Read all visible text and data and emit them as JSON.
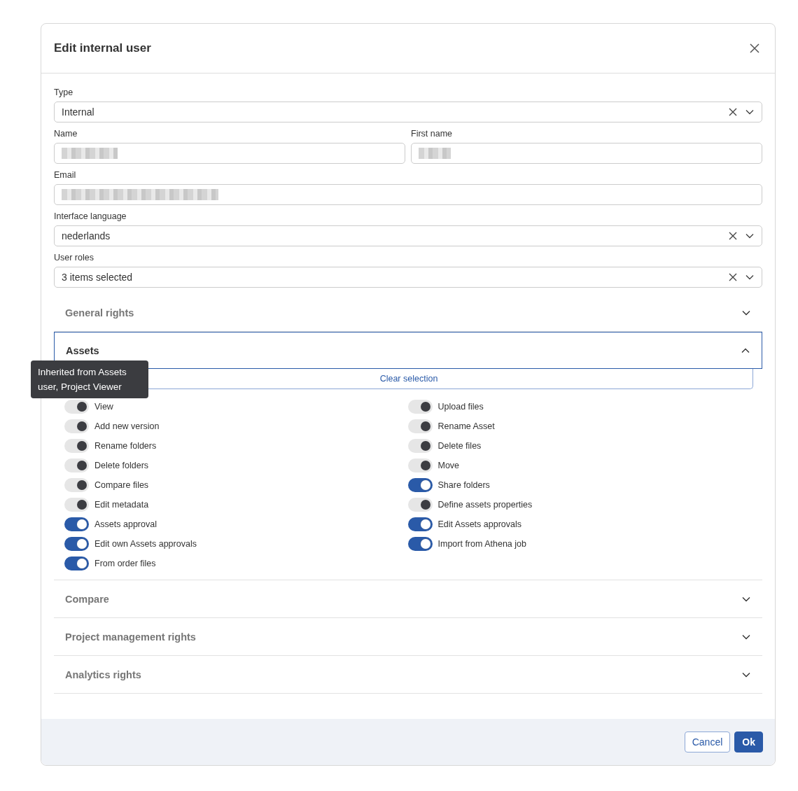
{
  "dialog": {
    "title": "Edit internal user"
  },
  "form_rows": [
    [
      {
        "label": "Type",
        "kind": "select",
        "value": "Internal",
        "redacted": false
      }
    ],
    [
      {
        "label": "Name",
        "kind": "text",
        "redacted": true
      },
      {
        "label": "First name",
        "kind": "text",
        "redacted": true
      }
    ],
    [
      {
        "label": "Email",
        "kind": "text",
        "redacted": true
      }
    ],
    [
      {
        "label": "Interface language",
        "kind": "select",
        "value": "nederlands",
        "redacted": false
      }
    ],
    [
      {
        "label": "User roles",
        "kind": "select",
        "value": "3 items selected",
        "redacted": false
      }
    ]
  ],
  "sections": [
    {
      "title": "General rights",
      "expanded": false
    },
    {
      "title": "Assets",
      "expanded": true,
      "clear_button": "Clear selection",
      "tooltip": "Inherited from Assets user, Project Viewer",
      "permissions_left": [
        {
          "label": "View",
          "on": true,
          "inherited": true
        },
        {
          "label": "Add new version",
          "on": true,
          "inherited": true
        },
        {
          "label": "Rename folders",
          "on": true,
          "inherited": true
        },
        {
          "label": "Delete folders",
          "on": true,
          "inherited": true
        },
        {
          "label": "Compare files",
          "on": true,
          "inherited": true
        },
        {
          "label": "Edit metadata",
          "on": true,
          "inherited": true
        },
        {
          "label": "Assets approval",
          "on": true,
          "inherited": false
        },
        {
          "label": "Edit own Assets approvals",
          "on": true,
          "inherited": false
        },
        {
          "label": "From order files",
          "on": true,
          "inherited": false
        }
      ],
      "permissions_right": [
        {
          "label": "Upload files",
          "on": true,
          "inherited": true
        },
        {
          "label": "Rename Asset",
          "on": true,
          "inherited": true
        },
        {
          "label": "Delete files",
          "on": true,
          "inherited": true
        },
        {
          "label": "Move",
          "on": true,
          "inherited": true
        },
        {
          "label": "Share folders",
          "on": true,
          "inherited": false
        },
        {
          "label": "Define assets properties",
          "on": true,
          "inherited": true
        },
        {
          "label": "Edit Assets approvals",
          "on": true,
          "inherited": false
        },
        {
          "label": "Import from Athena job",
          "on": true,
          "inherited": false
        }
      ]
    },
    {
      "title": "Compare",
      "expanded": false
    },
    {
      "title": "Project management rights",
      "expanded": false
    },
    {
      "title": "Analytics rights",
      "expanded": false
    }
  ],
  "footer": {
    "buttons": [
      {
        "label": "Cancel",
        "kind": "secondary"
      },
      {
        "label": "Ok",
        "kind": "primary"
      }
    ]
  }
}
